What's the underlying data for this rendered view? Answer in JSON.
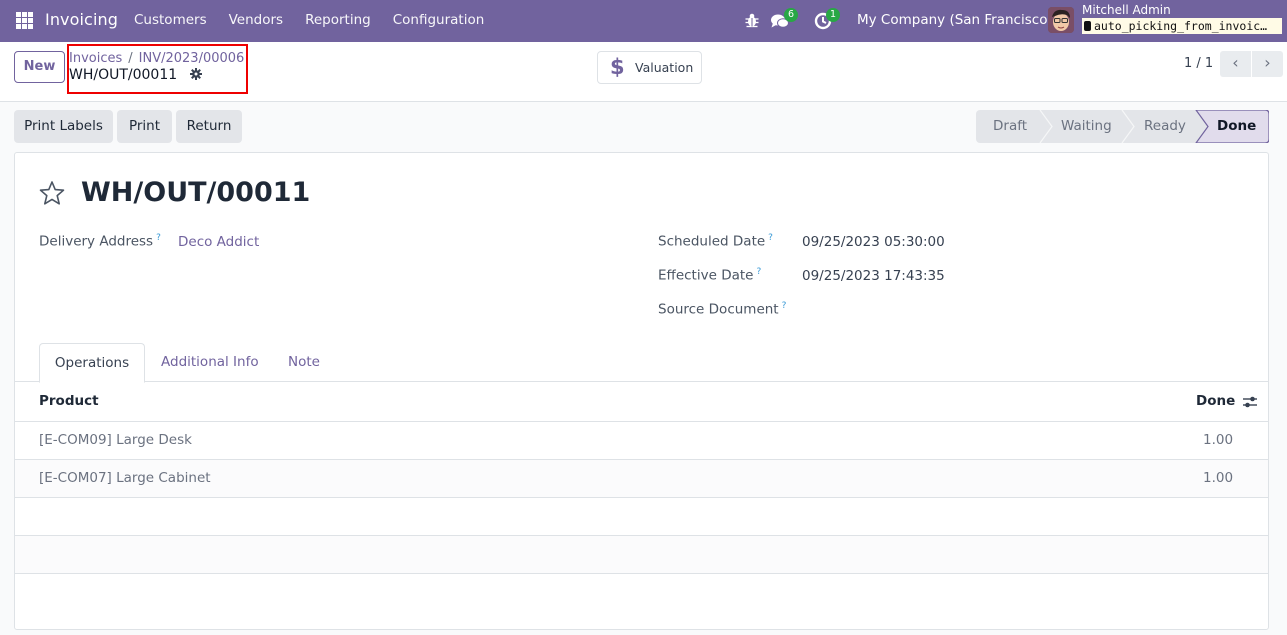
{
  "navbar": {
    "app_name": "Invoicing",
    "menu": [
      "Customers",
      "Vendors",
      "Reporting",
      "Configuration"
    ],
    "messages_count": "6",
    "activities_count": "1",
    "company": "My Company (San Francisco)",
    "user_name": "Mitchell Admin",
    "database": "auto_picking_from_invoic…"
  },
  "control": {
    "new_label": "New",
    "breadcrumb": [
      "Invoices",
      "INV/2023/00006"
    ],
    "breadcrumb_sep": "/",
    "current": "WH/OUT/00011",
    "valuation_label": "Valuation",
    "valuation_icon": "$",
    "pager": "1 / 1",
    "prev": "‹",
    "next": "›"
  },
  "actions": [
    "Print Labels",
    "Print",
    "Return"
  ],
  "status": {
    "steps": [
      "Draft",
      "Waiting",
      "Ready",
      "Done"
    ],
    "current": "Done"
  },
  "record": {
    "title": "WH/OUT/00011",
    "fields_left": [
      {
        "label": "Delivery Address",
        "help": "?",
        "value": "Deco Addict"
      }
    ],
    "fields_right": [
      {
        "label": "Scheduled Date",
        "help": "?",
        "value": "09/25/2023 05:30:00"
      },
      {
        "label": "Effective Date",
        "help": "?",
        "value": "09/25/2023 17:43:35"
      },
      {
        "label": "Source Document",
        "help": "?",
        "value": ""
      }
    ]
  },
  "tabs": [
    "Operations",
    "Additional Info",
    "Note"
  ],
  "active_tab": "Operations",
  "table": {
    "columns": [
      "Product",
      "Done"
    ],
    "rows": [
      {
        "product": "[E-COM09] Large Desk",
        "done": "1.00"
      },
      {
        "product": "[E-COM07] Large Cabinet",
        "done": "1.00"
      }
    ]
  },
  "colors": {
    "brand": "#71639e",
    "badge": "#28a745",
    "highlight_border": "#ee0000"
  }
}
